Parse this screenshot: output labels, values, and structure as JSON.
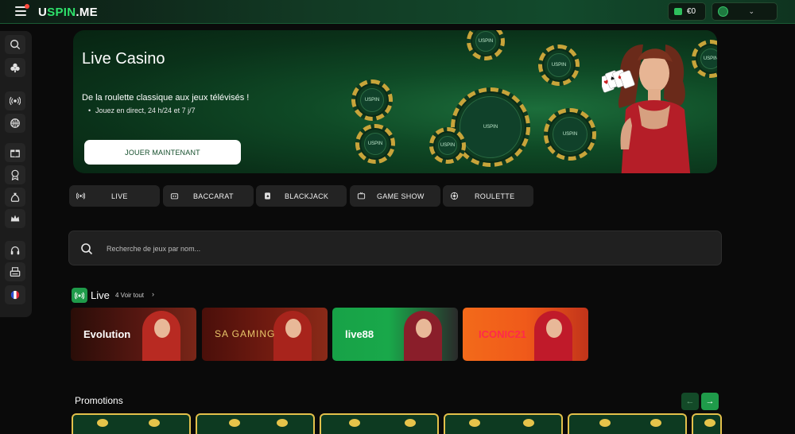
{
  "header": {
    "logo_part1": "U",
    "logo_part2": "SPIN",
    "logo_part3": ".ME",
    "balance": "€0"
  },
  "sidebar": {
    "items": [
      "search-icon",
      "club-icon",
      "live-broadcast-icon",
      "basketball-icon",
      "gift-icon",
      "award-icon",
      "money-bag-icon",
      "crown-icon",
      "headset-icon",
      "cashier-icon",
      "france-flag-icon"
    ]
  },
  "hero": {
    "title": "Live Casino",
    "subtitle": "De la roulette classique aux jeux télévisés !",
    "bullet": "Jouez en direct, 24 h/24 et 7 j/7",
    "cta": "JOUER MAINTENANT",
    "chip_label": "USPIN"
  },
  "categories": [
    {
      "label": "LIVE",
      "icon": "live-broadcast-icon"
    },
    {
      "label": "BACCARAT",
      "icon": "cards-icon"
    },
    {
      "label": "BLACKJACK",
      "icon": "card-icon"
    },
    {
      "label": "GAME SHOW",
      "icon": "tv-icon"
    },
    {
      "label": "ROULETTE",
      "icon": "roulette-icon"
    }
  ],
  "search": {
    "placeholder": "Recherche de jeux par nom..."
  },
  "live_section": {
    "title": "Live",
    "see_all": "4 Voir tout",
    "providers": [
      {
        "name": "Evolution",
        "bg": "#5a1812"
      },
      {
        "name": "SA GAMING",
        "bg": "#6e1a10"
      },
      {
        "name": "live88",
        "bg": "#1aa84a"
      },
      {
        "name": "ICONIC21",
        "bg": "#f05a1a"
      }
    ]
  },
  "promotions": {
    "title": "Promotions",
    "prev": "←",
    "next": "→"
  },
  "colors": {
    "accent": "#1f9b4a",
    "background": "#0a0a0a",
    "panel": "#232323"
  }
}
